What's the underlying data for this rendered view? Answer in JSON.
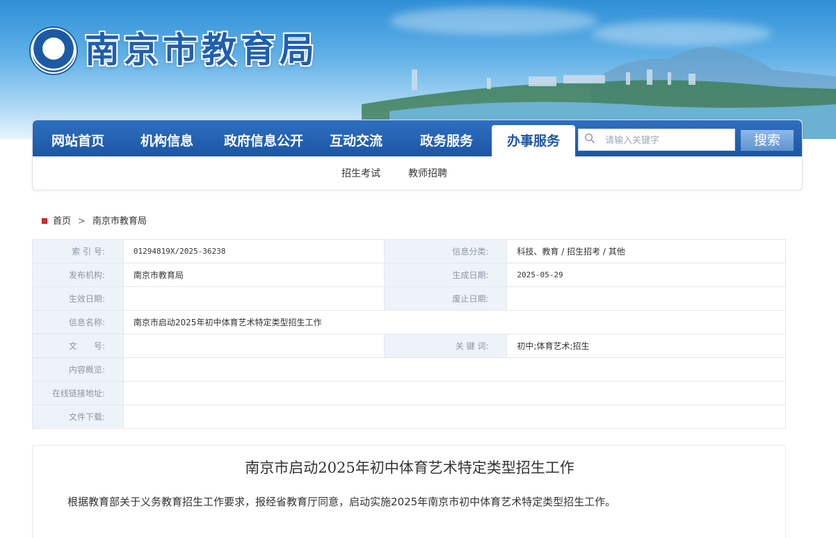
{
  "header": {
    "site_title": "南京市教育局"
  },
  "nav": {
    "items": [
      {
        "label": "网站首页"
      },
      {
        "label": "机构信息"
      },
      {
        "label": "政府信息公开"
      },
      {
        "label": "互动交流"
      },
      {
        "label": "政务服务"
      },
      {
        "label": "办事服务",
        "active": true
      }
    ],
    "search_placeholder": "请输入关键字",
    "search_button": "搜索",
    "subnav": [
      {
        "label": "招生考试"
      },
      {
        "label": "教师招聘"
      }
    ]
  },
  "breadcrumb": {
    "home": "首页",
    "separator": ">",
    "current": "南京市教育局"
  },
  "info": {
    "index_label": "索 引 号:",
    "index_value": "01294819X/2025-36238",
    "category_label": "信息分类:",
    "category_value": "科技、教育 / 招生招考 / 其他",
    "publisher_label": "发布机构:",
    "publisher_value": "南京市教育局",
    "created_label": "生成日期:",
    "created_value": "2025-05-29",
    "effective_label": "生效日期:",
    "effective_value": "",
    "abolished_label": "废止日期:",
    "abolished_value": "",
    "name_label": "信息名称:",
    "name_value": "南京市启动2025年初中体育艺术特定类型招生工作",
    "doc_no_label": "文　　号:",
    "doc_no_value": "",
    "keywords_label": "关 键 词:",
    "keywords_value": "初中;体育艺术;招生",
    "summary_label": "内容概览:",
    "summary_value": "",
    "link_label": "在线链接地址:",
    "link_value": "",
    "download_label": "文件下载:",
    "download_value": ""
  },
  "article": {
    "title": "南京市启动2025年初中体育艺术特定类型招生工作",
    "body": "根据教育部关于义务教育招生工作要求，报经省教育厅同意，启动实施2025年南京市初中体育艺术特定类型招生工作。"
  }
}
